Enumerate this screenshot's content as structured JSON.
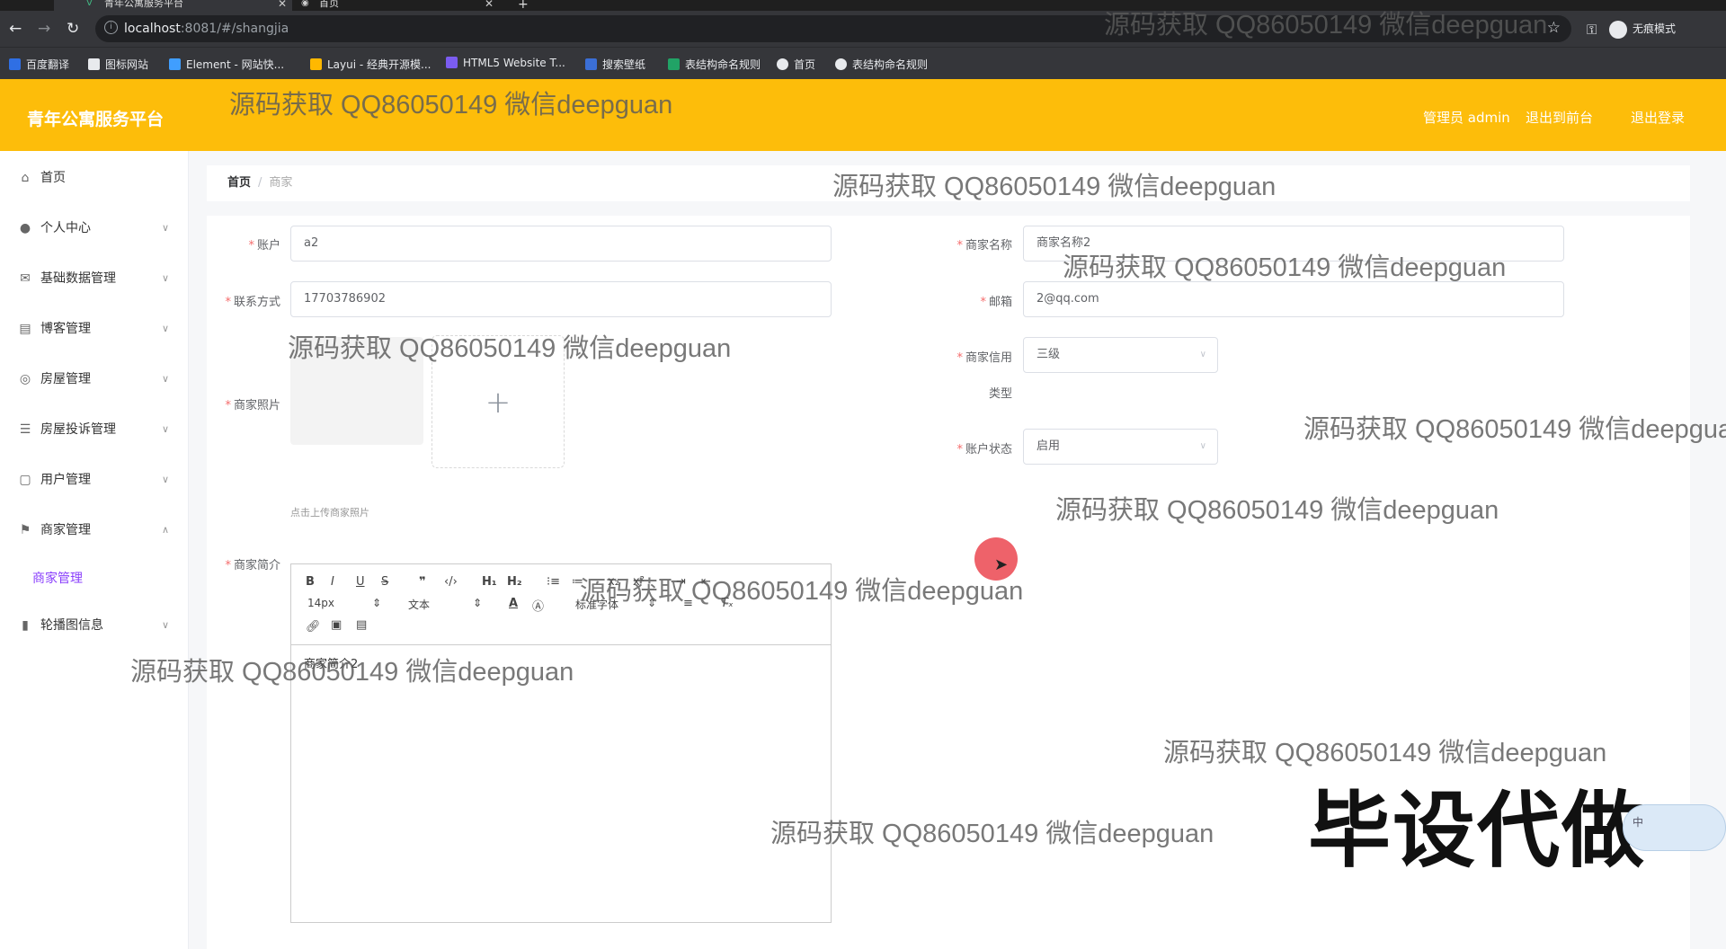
{
  "browser": {
    "tabs": [
      {
        "title": "青年公寓服务平台",
        "active": true
      },
      {
        "title": "首页",
        "active": false
      }
    ],
    "new_tab": "+",
    "url_host": "localhost",
    "url_rest": ":8081/#/shangjia",
    "incognito_label": "无痕模式",
    "bookmarks": [
      {
        "label": "百度翻译",
        "color": "#2f6fe4"
      },
      {
        "label": "图标网站",
        "color": "#e8eaed"
      },
      {
        "label": "Element - 网站快...",
        "color": "#409eff"
      },
      {
        "label": "Layui - 经典开源模...",
        "color": "#ffb800"
      },
      {
        "label": "HTML5 Website T...",
        "color": "#7b5cf0"
      },
      {
        "label": "搜索壁纸",
        "color": "#3b6fd6"
      },
      {
        "label": "表结构命名规则",
        "color": "#21a366"
      },
      {
        "label": "首页",
        "color": "#e8eaed"
      },
      {
        "label": "表结构命名规则",
        "color": "#e8eaed"
      }
    ]
  },
  "header": {
    "title": "青年公寓服务平台",
    "admin_label": "管理员 admin",
    "back_label": "退出到前台",
    "logout_label": "退出登录",
    "bg_color": "#fdbd0a"
  },
  "sidebar": {
    "items": [
      {
        "label": "首页",
        "icon": "home-icon"
      },
      {
        "label": "个人中心",
        "icon": "user-icon"
      },
      {
        "label": "基础数据管理",
        "icon": "mail-icon"
      },
      {
        "label": "博客管理",
        "icon": "doc-icon"
      },
      {
        "label": "房屋管理",
        "icon": "compass-icon"
      },
      {
        "label": "房屋投诉管理",
        "icon": "sliders-icon"
      },
      {
        "label": "用户管理",
        "icon": "crop-icon"
      },
      {
        "label": "商家管理",
        "icon": "flag-icon"
      },
      {
        "label": "轮播图信息",
        "icon": "chart-icon"
      }
    ],
    "sub_item": "商家管理",
    "accent_color": "#8a3ffc"
  },
  "breadcrumb": {
    "home": "首页",
    "sep": "/",
    "current": "商家"
  },
  "form": {
    "account": {
      "label": "账户",
      "value": "a2"
    },
    "name": {
      "label": "商家名称",
      "value": "商家名称2"
    },
    "phone": {
      "label": "联系方式",
      "value": "17703786902"
    },
    "email": {
      "label": "邮箱",
      "value": "2@qq.com"
    },
    "credit": {
      "label_line1": "商家信用",
      "label_line2": "类型",
      "value": "三级"
    },
    "photo": {
      "label": "商家照片",
      "hint": "点击上传商家照片"
    },
    "status": {
      "label": "账户状态",
      "value": "启用"
    },
    "intro": {
      "label": "商家简介",
      "content": "商家简介2"
    }
  },
  "editor": {
    "size": "14px",
    "heading": "文本",
    "font": "标准字体"
  },
  "watermark_text": "源码获取 QQ86050149 微信deepguan",
  "badge_text": "毕设代做",
  "bubble_text": "中"
}
